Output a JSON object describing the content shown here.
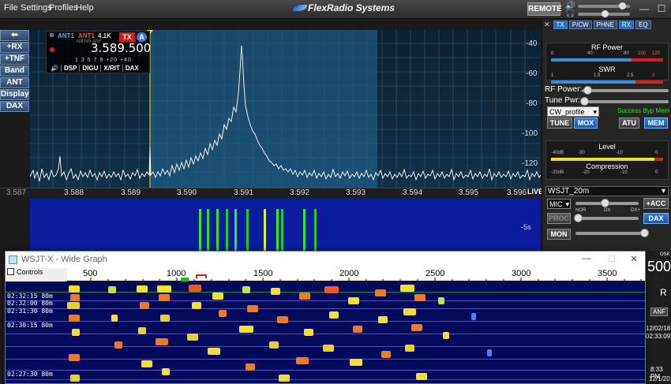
{
  "menu": {
    "items": [
      "File",
      "Settings",
      "Profiles",
      "Help"
    ],
    "brand": "FlexRadio Systems",
    "remote": "REMOTE"
  },
  "left_buttons": [
    "⬅",
    "+RX",
    "+TNF",
    "Band",
    "ANT",
    "Display",
    "DAX"
  ],
  "slice": {
    "ant_tx": "ANT1",
    "ant_rx": "ANT1",
    "bandwidth": "4.1K",
    "mode": "NB NR ANF",
    "frequency": "3.589.500",
    "tx": "TX",
    "letter": "A",
    "scale": "1 3 5 7 9 +20 +40",
    "tabs": [
      "🔊",
      "DSP",
      "DIGU",
      "X/RIT",
      "DAX"
    ]
  },
  "pan": {
    "db_labels": [
      "-40",
      "-60",
      "-80",
      "-100",
      "-120"
    ],
    "freq_labels": [
      "3.587",
      "3.588",
      "3.589",
      "3.590",
      "3.591",
      "3.592",
      "3.593",
      "3.594",
      "3.595",
      "3.596"
    ],
    "live": "LIVE",
    "wf_time": "-5s"
  },
  "right_panel": {
    "tabs": [
      "TX",
      "P/CW",
      "PHNE",
      "RX",
      "EQ"
    ],
    "rf_power_meter": {
      "title": "RF Power",
      "scale": [
        "0",
        "40",
        "80",
        "100",
        "120"
      ]
    },
    "swr_meter": {
      "title": "SWR",
      "scale": [
        "1",
        "1.5",
        "2.5",
        "3"
      ]
    },
    "rf_power_label": "RF Power:",
    "tune_pwr_label": "Tune Pwr:",
    "profile": "CW_profile",
    "status": "Success  Byp  Mem",
    "tune": "TUNE",
    "mox": "MOX",
    "atu": "ATU",
    "mem": "MEM",
    "level_meter": {
      "title": "Level",
      "scale": [
        "-40dB",
        "-30",
        "-10",
        "0"
      ]
    },
    "compression_meter": {
      "title": "Compression",
      "scale": [
        "-25dB",
        "-20",
        "-10",
        "0"
      ]
    },
    "dax_profile": "WSJT_20m",
    "mic": "MIC",
    "acc": "+ACC",
    "nor": "NOR",
    "dx": "DX",
    "dxplus": "DX+",
    "proc": "PROC",
    "dax": "DAX",
    "mon": "MON"
  },
  "wsjt": {
    "title": "WSJT-X - Wide Graph",
    "controls_label": "Controls",
    "ruler": [
      "500",
      "1000",
      "1500",
      "2000",
      "2500",
      "3000",
      "3500"
    ],
    "time_labels": [
      "02:32:15   80m",
      "02:32:00   80m",
      "02:31:30   80m",
      "02:30:15   80m",
      "02:27:30   80m"
    ]
  },
  "right_edge": {
    "r": "R",
    "anf": "ANF",
    "date1": "12/02/18",
    "time1": "02:33:09Z",
    "time2": "8:33 PM",
    "date2": "12/1/201",
    "partial": "500",
    "osk": "OSK"
  }
}
